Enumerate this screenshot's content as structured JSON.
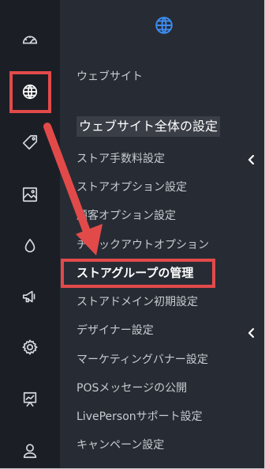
{
  "sidebar": {
    "icons": [
      {
        "name": "dashboard-gauge-icon",
        "active": false
      },
      {
        "name": "globe-icon",
        "active": true
      },
      {
        "name": "tag-icon",
        "active": false
      },
      {
        "name": "image-icon",
        "active": false
      },
      {
        "name": "droplet-icon",
        "active": false
      },
      {
        "name": "megaphone-icon",
        "active": false
      },
      {
        "name": "settings-gear-icon",
        "active": false
      },
      {
        "name": "presentation-chart-icon",
        "active": false
      },
      {
        "name": "user-icon",
        "active": false
      }
    ]
  },
  "panel": {
    "header_icon": "globe-icon",
    "website_label": "ウェブサイト",
    "section_title": "ウェブサイト全体の設定",
    "items": [
      {
        "label": "ストア手数料設定",
        "has_submenu": true
      },
      {
        "label": "ストアオプション設定",
        "has_submenu": false
      },
      {
        "label": "顧客オプション設定",
        "has_submenu": false
      },
      {
        "label": "チェックアウトオプション",
        "has_submenu": false
      },
      {
        "label": "ストアグループの管理",
        "has_submenu": false,
        "highlighted": true
      },
      {
        "label": "ストアドメイン初期設定",
        "has_submenu": false
      },
      {
        "label": "デザイナー設定",
        "has_submenu": true
      },
      {
        "label": "マーケティングバナー設定",
        "has_submenu": false
      },
      {
        "label": "POSメッセージの公開",
        "has_submenu": false
      },
      {
        "label": "LivePersonサポート設定",
        "has_submenu": false
      },
      {
        "label": "キャンペーン設定",
        "has_submenu": false
      }
    ]
  },
  "colors": {
    "rail_bg": "#1b1f25",
    "panel_bg": "#272c34",
    "highlight": "#e24a4a",
    "accent_globe": "#3d8df2"
  }
}
